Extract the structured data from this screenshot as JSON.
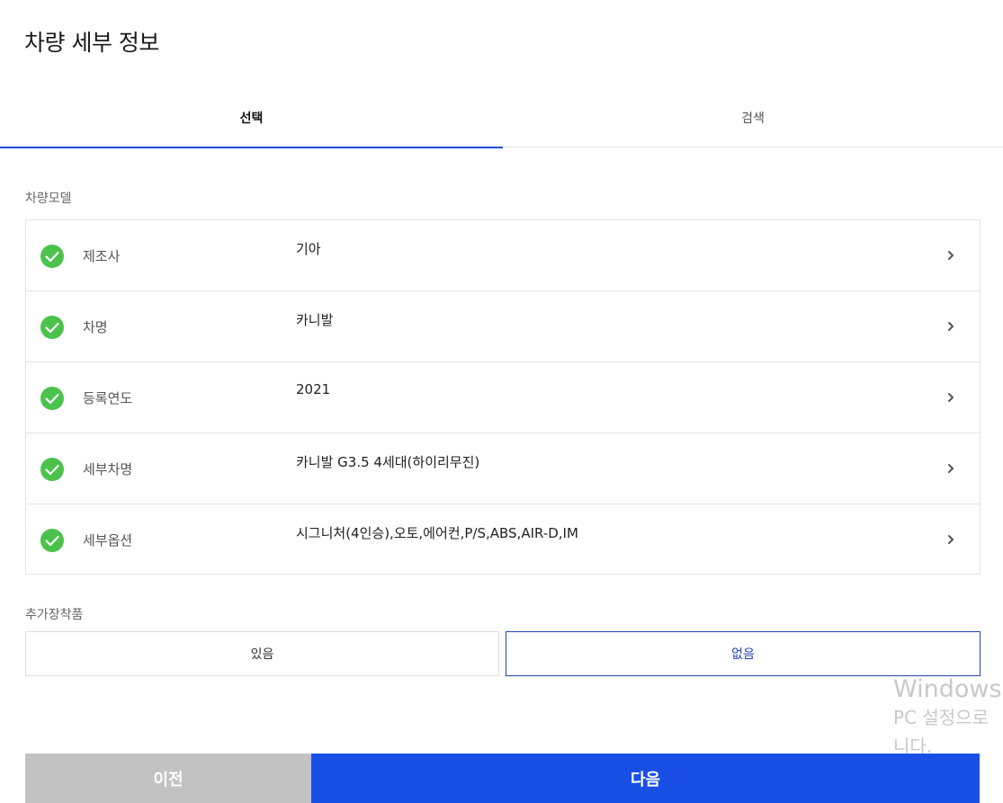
{
  "page": {
    "title": "차량 세부 정보"
  },
  "tabs": [
    {
      "label": "선택",
      "active": true
    },
    {
      "label": "검색",
      "active": false
    }
  ],
  "model_section": {
    "label": "차량모델",
    "rows": [
      {
        "key": "제조사",
        "value": "기아"
      },
      {
        "key": "차명",
        "value": "카니발"
      },
      {
        "key": "등록연도",
        "value": "2021"
      },
      {
        "key": "세부차명",
        "value": "카니발 G3.5 4세대(하이리무진)"
      },
      {
        "key": "세부옵션",
        "value": "시그니처(4인승),오토,에어컨,P/S,ABS,AIR-D,IM"
      }
    ]
  },
  "extra_section": {
    "label": "추가장착품",
    "options": [
      {
        "label": "있음",
        "selected": false
      },
      {
        "label": "없음",
        "selected": true
      }
    ]
  },
  "footer": {
    "prev_label": "이전",
    "next_label": "다음"
  },
  "watermark": {
    "line1": "Windows",
    "line2": "PC 설정으로",
    "line3": "니다."
  },
  "colors": {
    "accent": "#1a4fe6",
    "check": "#4bc24b",
    "disabled": "#c2c2c2",
    "selected_border": "#2446b0"
  },
  "icons": {
    "row_status": "check-circle-icon",
    "row_arrow": "chevron-right-icon"
  }
}
